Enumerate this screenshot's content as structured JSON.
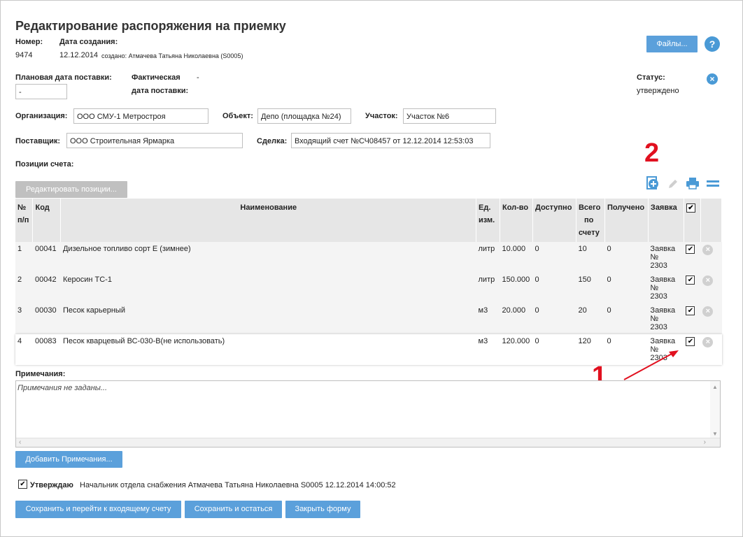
{
  "title": "Редактирование распоряжения на приемку",
  "header": {
    "number_label": "Номер:",
    "number_value": "9474",
    "created_label": "Дата создания:",
    "created_value": "12.12.2014",
    "created_by": "создано: Атмачева Татьяна Николаевна (S0005)",
    "files_button": "Файлы...",
    "help_icon": "?"
  },
  "dates": {
    "planned_label": "Плановая дата поставки:",
    "planned_value": "-",
    "actual_label_1": "Фактическая",
    "actual_label_2": "дата поставки:",
    "actual_value": "-"
  },
  "status": {
    "label": "Статус:",
    "value": "утверждено"
  },
  "fields": {
    "org_label": "Организация:",
    "org_value": "ООО СМУ-1 Метростроя",
    "object_label": "Объект:",
    "object_value": "Депо (площадка №24)",
    "section_label": "Участок:",
    "section_value": "Участок №6",
    "supplier_label": "Поставщик:",
    "supplier_value": "ООО Строительная Ярмарка",
    "deal_label": "Сделка:",
    "deal_value": "Входящий счет №СЧ08457 от 12.12.2014 12:53:03"
  },
  "positions": {
    "label": "Позиции счета:",
    "edit_button": "Редактировать позиции...",
    "columns": {
      "num_1": "№",
      "num_2": "п/п",
      "code": "Код",
      "name": "Наименование",
      "unit_1": "Ед.",
      "unit_2": "изм.",
      "qty": "Кол-во",
      "avail": "Доступно",
      "total_1": "Всего",
      "total_2": "по",
      "total_3": "счету",
      "received": "Получено",
      "request": "Заявка"
    },
    "rows": [
      {
        "num": "1",
        "code": "00041",
        "name": "Дизельное топливо сорт Е (зимнее)",
        "unit": "литр",
        "qty": "10.000",
        "avail": "0",
        "total": "10",
        "received": "0",
        "req1": "Заявка",
        "req2": "№",
        "req3": "2303"
      },
      {
        "num": "2",
        "code": "00042",
        "name": "Керосин ТС-1",
        "unit": "литр",
        "qty": "150.000",
        "avail": "0",
        "total": "150",
        "received": "0",
        "req1": "Заявка",
        "req2": "№",
        "req3": "2303"
      },
      {
        "num": "3",
        "code": "00030",
        "name": "Песок карьерный",
        "unit": "м3",
        "qty": "20.000",
        "avail": "0",
        "total": "20",
        "received": "0",
        "req1": "Заявка",
        "req2": "№",
        "req3": "2303"
      },
      {
        "num": "4",
        "code": "00083",
        "name": "Песок кварцевый ВС-030-В(не использовать)",
        "unit": "м3",
        "qty": "120.000",
        "avail": "0",
        "total": "120",
        "received": "0",
        "req1": "Заявка",
        "req2": "№",
        "req3": "2303"
      }
    ]
  },
  "notes": {
    "label": "Примечания:",
    "placeholder": "Примечания не заданы...",
    "add_button": "Добавить Примечания..."
  },
  "approve": {
    "label": "Утверждаю",
    "text": "Начальник отдела снабжения Атмачева Татьяна Николаевна S0005 12.12.2014 14:00:52"
  },
  "footer": {
    "save_go": "Сохранить и перейти к входящему счету",
    "save_stay": "Сохранить и остаться",
    "close": "Закрыть форму"
  },
  "annotations": {
    "one": "1",
    "two": "2"
  },
  "colors": {
    "accent": "#5ba0db",
    "annotation": "#e1101f"
  }
}
